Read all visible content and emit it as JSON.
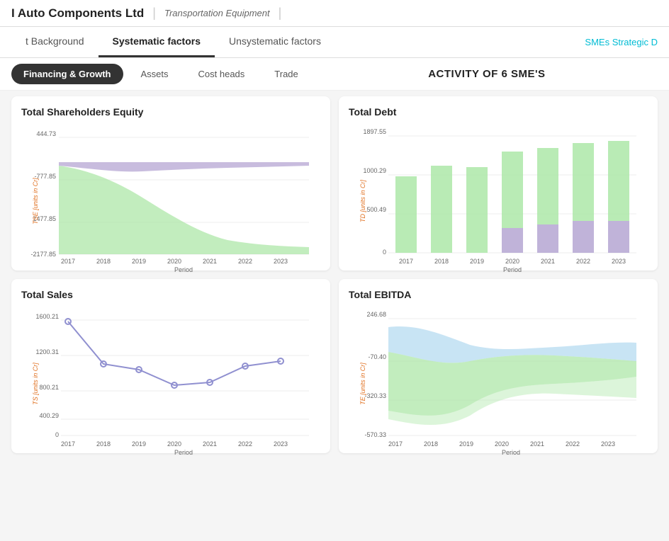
{
  "header": {
    "company": "I Auto Components Ltd",
    "sector": "Transportation Equipment"
  },
  "tabs": {
    "items": [
      {
        "label": "t Background",
        "active": false
      },
      {
        "label": "Systematic factors",
        "active": true
      },
      {
        "label": "Unsystematic factors",
        "active": false
      }
    ],
    "right_link": "SMEs Strategic D"
  },
  "sub_tabs": {
    "items": [
      {
        "label": "Financing & Growth",
        "active": true
      },
      {
        "label": "Assets",
        "active": false
      },
      {
        "label": "Cost heads",
        "active": false
      },
      {
        "label": "Trade",
        "active": false
      }
    ]
  },
  "activity_header": "ACTIVITY OF 6 SME'S",
  "charts": {
    "tse": {
      "title": "Total Shareholders Equity",
      "y_axis_title": "TSE [units in Cr]",
      "x_axis_title": "Period",
      "y_labels": [
        "444.73",
        "-777.85",
        "1477.85",
        "-2177.85"
      ],
      "x_labels": [
        "2017",
        "2018",
        "2019",
        "2020",
        "2021",
        "2022",
        "2023"
      ]
    },
    "td": {
      "title": "Total Debt",
      "y_axis_title": "TD [units in Cr]",
      "x_axis_title": "Period",
      "y_labels": [
        "1897.55",
        "1000.29",
        "500.49",
        "0"
      ],
      "x_labels": [
        "2017",
        "2018",
        "2019",
        "2020",
        "2021",
        "2022",
        "2023"
      ]
    },
    "ts": {
      "title": "Total Sales",
      "y_axis_title": "TS [units in Cr]",
      "x_axis_title": "Period",
      "y_labels": [
        "1600.21",
        "1200.31",
        "800.21",
        "400.29",
        "0"
      ],
      "x_labels": [
        "2017",
        "2018",
        "2019",
        "2020",
        "2021",
        "2022",
        "2023"
      ]
    },
    "te": {
      "title": "Total EBITDA",
      "y_axis_title": "TE [units in Cr]",
      "x_axis_title": "Period",
      "y_labels": [
        "246.68",
        "-70.40",
        "-320.33",
        "-570.33"
      ],
      "x_labels": [
        "2017",
        "2018",
        "2019",
        "2020",
        "2021",
        "2022",
        "2023"
      ]
    }
  }
}
